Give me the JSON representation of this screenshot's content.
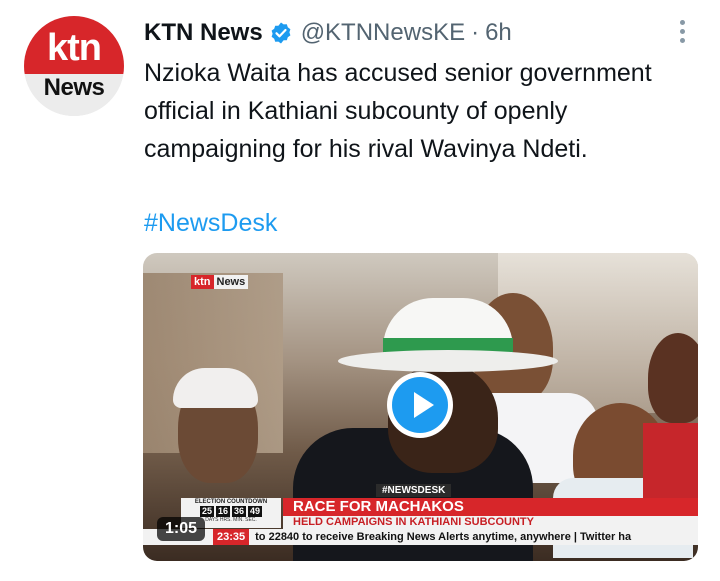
{
  "tweet": {
    "author_name": "KTN News",
    "handle": "@KTNNewsKE",
    "separator": "·",
    "time": "6h",
    "text": "Nzioka Waita has accused senior government official in Kathiani subcounty of openly campaigning for his rival Wavinya Ndeti.",
    "hashtag": "#NewsDesk",
    "verified_icon": "verified-badge-icon",
    "more_icon": "more-options-icon"
  },
  "avatar": {
    "top_text": "ktn",
    "bottom_text": "News"
  },
  "media": {
    "duration": "1:05",
    "logo_left": "ktn",
    "logo_right": "News",
    "newsdesk_tag": "#NEWSDESK",
    "headline": "RACE FOR MACHAKOS",
    "subheadline": "HELD CAMPAIGNS IN KATHIANI SUBCOUNTY",
    "countdown_label": "ELECTION COUNTDOWN",
    "countdown": [
      "25",
      "16",
      "36",
      "49"
    ],
    "countdown_units": "DAYS HRS. MIN. SEC.",
    "clock": "23:35",
    "ticker": "to 22840 to receive Breaking News Alerts anytime, anywhere | Twitter ha"
  },
  "colors": {
    "accent_blue": "#1d9bf0",
    "ktn_red": "#d7262a",
    "text_primary": "#0f1419",
    "text_secondary": "#536471"
  }
}
